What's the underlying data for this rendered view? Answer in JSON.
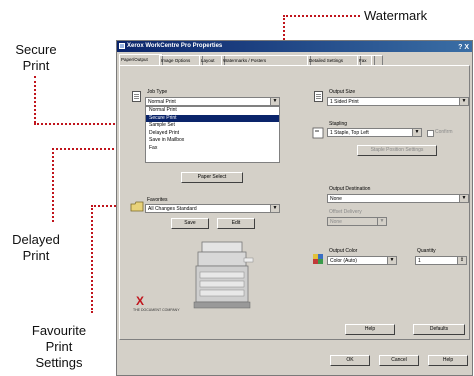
{
  "callouts": {
    "watermark": "Watermark",
    "secure_print": [
      "Secure",
      "Print"
    ],
    "delayed_print": [
      "Delayed",
      "Print"
    ],
    "favourite_settings": [
      "Favourite",
      "Print",
      "Settings"
    ]
  },
  "colors": {
    "leader_line": "#c0141c",
    "title_bar": "#0a246a",
    "dialog_face": "#d4d0c8",
    "selection": "#0a246a",
    "brand": "#c0141c"
  },
  "dialog": {
    "title": "Xerox WorkCentre Pro Properties",
    "title_controls": "? X",
    "tabs": [
      "Paper/Output",
      "Image Options",
      "Layout",
      "Watermarks / Posters",
      "Detailed Settings",
      "Fax",
      ""
    ],
    "job_type": {
      "label": "Job Type",
      "value": "Normal Print",
      "options": [
        "Normal Print",
        "Secure Print",
        "Sample Set",
        "Delayed Print",
        "Save in Mailbox",
        "Fax"
      ],
      "selected_index": 1
    },
    "paper_select_button": "Paper Select",
    "favorites": {
      "label": "Favorites",
      "value": "All Changes Standard",
      "save_button": "Save",
      "edit_button": "Edit"
    },
    "output_size": {
      "label": "Output Size",
      "value": "1 Sided Print"
    },
    "stapling": {
      "label": "Stapling",
      "value": "1 Staple, Top Left",
      "checkbox_label": "Confirm"
    },
    "staple_position_button": "Staple Position Settings",
    "output_destination": {
      "label": "Output Destination",
      "value": "None"
    },
    "offset_delivery": {
      "label": "Offset Delivery",
      "value": "None"
    },
    "output_color": {
      "label": "Output Color",
      "value": "Color (Auto)"
    },
    "quantity": {
      "label": "Quantity",
      "value": "1"
    },
    "help_button": "Help",
    "defaults_button": "Defaults",
    "ok_button": "OK",
    "cancel_button": "Cancel",
    "apply_button": "Help",
    "brand": {
      "logo": "X",
      "tagline": "THE DOCUMENT COMPANY"
    }
  }
}
